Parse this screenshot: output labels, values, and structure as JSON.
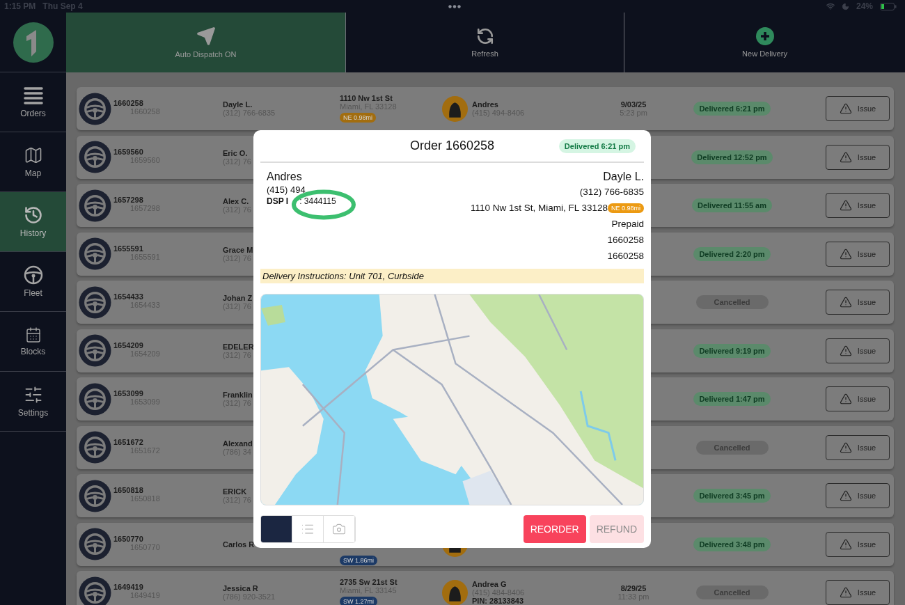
{
  "status_bar": {
    "time": "1:15 PM",
    "date": "Thu Sep 4",
    "battery": "24%"
  },
  "toolbar": [
    {
      "kind": "dispatch",
      "label": "Auto Dispatch ON",
      "on": true
    },
    {
      "kind": "refresh",
      "label": "Refresh",
      "on": false
    },
    {
      "kind": "new",
      "label": "New Delivery",
      "on": false
    }
  ],
  "sidebar": {
    "items": [
      {
        "kind": "orders",
        "label": "Orders",
        "selected": false
      },
      {
        "kind": "map",
        "label": "Map",
        "selected": false
      },
      {
        "kind": "history",
        "label": "History",
        "selected": true
      },
      {
        "kind": "fleet",
        "label": "Fleet",
        "selected": false
      },
      {
        "kind": "blocks",
        "label": "Blocks",
        "selected": false
      },
      {
        "kind": "settings",
        "label": "Settings",
        "selected": false
      }
    ]
  },
  "orders": [
    {
      "order_id": "1660258",
      "sub_id": "1660258",
      "customer": "Dayle L.",
      "phone": "(312) 766-6835",
      "address": "1110 Nw 1st St",
      "city": "Miami, FL 33128",
      "tag": {
        "text": "NE 0.98mi",
        "color": "#a26d0f"
      },
      "driver_avatar": true,
      "driver": {
        "name": "Andres",
        "phone": "(415) 494-8406"
      },
      "date": "9/03/25",
      "time": "5:23 pm",
      "status": {
        "kind": "delivered",
        "text": "Delivered 6:21 pm"
      },
      "action": "Issue"
    },
    {
      "order_id": "1659560",
      "sub_id": "1659560",
      "customer": "Eric O.",
      "phone": "(312) 76",
      "driver_avatar": false,
      "status": {
        "kind": "delivered",
        "text": "Delivered 12:52 pm"
      },
      "action": "Issue"
    },
    {
      "order_id": "1657298",
      "sub_id": "1657298",
      "customer": "Alex C.",
      "phone": "(312) 76",
      "driver_avatar": false,
      "status": {
        "kind": "delivered",
        "text": "Delivered 11:55 am"
      },
      "action": "Issue"
    },
    {
      "order_id": "1655591",
      "sub_id": "1655591",
      "customer": "Grace M",
      "phone": "(312) 76",
      "driver_avatar": false,
      "status": {
        "kind": "delivered",
        "text": "Delivered 2:20 pm"
      },
      "action": "Issue"
    },
    {
      "order_id": "1654433",
      "sub_id": "1654433",
      "customer": "Johan Z",
      "phone": "(312) 76",
      "driver_avatar": false,
      "status": {
        "kind": "cancelled",
        "text": "Cancelled"
      },
      "action": "Issue"
    },
    {
      "order_id": "1654209",
      "sub_id": "1654209",
      "customer": "EDELER",
      "phone": "(312) 76",
      "driver_avatar": false,
      "status": {
        "kind": "delivered",
        "text": "Delivered 9:19 pm"
      },
      "action": "Issue"
    },
    {
      "order_id": "1653099",
      "sub_id": "1653099",
      "customer": "Franklin",
      "phone": "(312) 76",
      "driver_avatar": false,
      "status": {
        "kind": "delivered",
        "text": "Delivered 1:47 pm"
      },
      "action": "Issue"
    },
    {
      "order_id": "1651672",
      "sub_id": "1651672",
      "customer": "Alexand",
      "phone": "(786) 34",
      "driver_avatar": false,
      "status": {
        "kind": "cancelled",
        "text": "Cancelled"
      },
      "action": "Issue"
    },
    {
      "order_id": "1650818",
      "sub_id": "1650818",
      "customer": "ERICK",
      "phone": "(312) 76",
      "driver_avatar": false,
      "status": {
        "kind": "delivered",
        "text": "Delivered 3:45 pm"
      },
      "action": "Issue"
    },
    {
      "order_id": "1650770",
      "sub_id": "1650770",
      "customer": "Carlos R",
      "tag": {
        "text": "SW 1.86mi",
        "color": "#1c3a66"
      },
      "driver_avatar": true,
      "status": {
        "kind": "delivered",
        "text": "Delivered 3:48 pm"
      },
      "action": "Issue"
    },
    {
      "order_id": "1649419",
      "sub_id": "1649419",
      "customer": "Jessica R",
      "phone": "(786) 920-3521",
      "address": "2735 Sw 21st St",
      "city": "Miami, FL 33145",
      "tag": {
        "text": "SW 1.27mi",
        "color": "#1c3a66"
      },
      "driver_avatar": true,
      "driver": {
        "name": "Andrea G",
        "phone": "(415) 484-8406",
        "pin": "PIN: 28133843"
      },
      "date": "8/29/25",
      "time": "11:33 pm",
      "status": {
        "kind": "cancelled",
        "text": "Cancelled"
      },
      "action": "Issue"
    }
  ],
  "modal": {
    "title": "Order 1660258",
    "status": {
      "kind": "delivered",
      "text": "Delivered 6:21 pm"
    },
    "driver": {
      "name": "Andres",
      "phone": "(415) 494",
      "dsp_label": "DSP I",
      "dsp_value": ": 3444115"
    },
    "customer": {
      "name": "Dayle L.",
      "phone": "(312) 766-6835",
      "address": "1110 Nw 1st St, Miami, FL 33128",
      "tag": {
        "text": "NE 0.98mi",
        "color": "#ec9a12"
      },
      "payment": "Prepaid",
      "ids": [
        "1660258",
        "1660258"
      ]
    },
    "instructions": "Delivery Instructions: Unit 701, Curbside",
    "view_tabs": [
      {
        "kind": "map",
        "selected": true
      },
      {
        "kind": "list",
        "selected": false
      },
      {
        "kind": "photo",
        "selected": false
      }
    ],
    "actions": [
      {
        "kind": "reorder",
        "label": "REORDER",
        "disabled": false
      },
      {
        "kind": "refund",
        "label": "REFUND",
        "disabled": true
      }
    ]
  }
}
